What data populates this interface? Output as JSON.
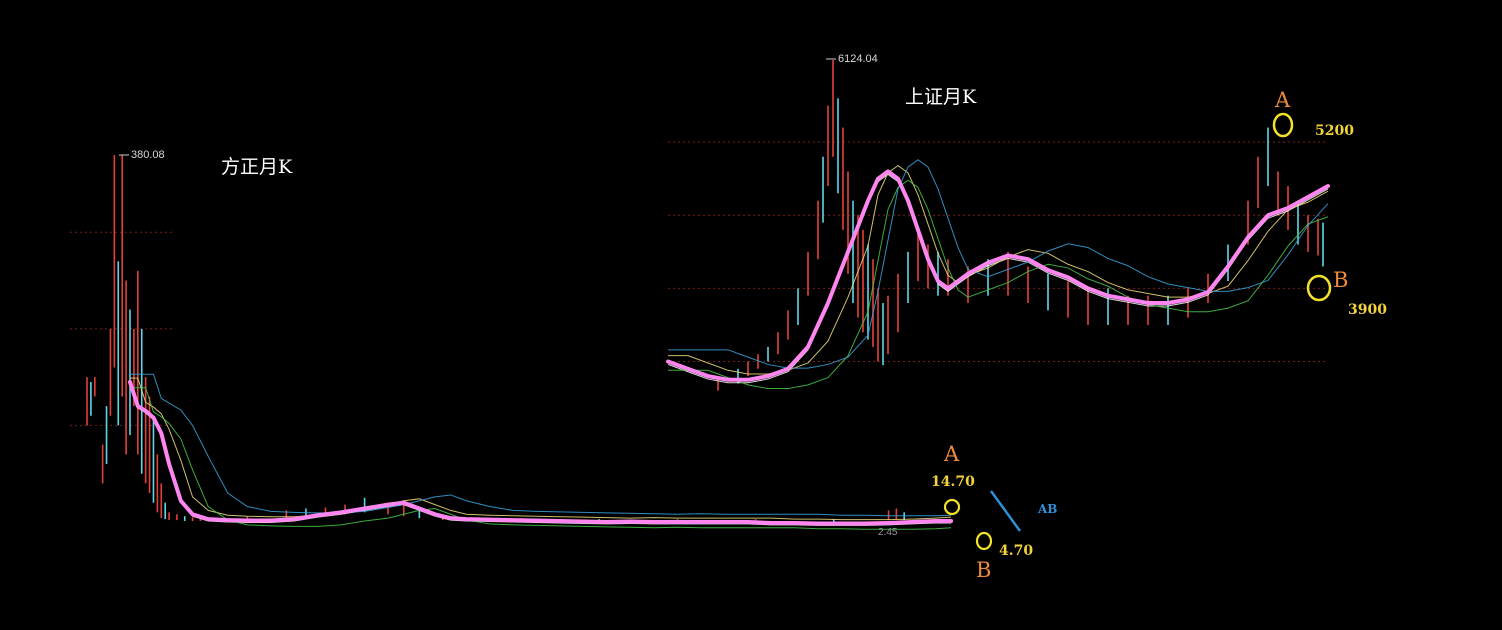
{
  "chart_data": [
    {
      "type": "line",
      "title": "方正月K",
      "peak_label": "380.08",
      "low_label": "2.45",
      "annotations": {
        "point_a_letter": "A",
        "point_a_value": "14.70",
        "point_b_letter": "B",
        "point_b_value": "4.70",
        "ab_label": "AB"
      },
      "ylim": [
        0,
        400
      ],
      "gridlines": [
        100,
        200,
        300
      ],
      "series": [
        {
          "color": "#ff86f0",
          "x": [
            0,
            2,
            4,
            6,
            8,
            10,
            13,
            16,
            20,
            25,
            30,
            36,
            42,
            48,
            54,
            60,
            66,
            70,
            74,
            78,
            82,
            86,
            92,
            98,
            104,
            110,
            116,
            122,
            128,
            134,
            140,
            146,
            152,
            158,
            164,
            170,
            176,
            182,
            188,
            194,
            200,
            206,
            210
          ],
          "y": [
            145,
            120,
            115,
            108,
            92,
            60,
            22,
            8,
            3,
            2,
            1.5,
            1.5,
            3,
            7,
            10,
            14,
            18,
            20,
            14,
            8,
            4,
            3,
            2.5,
            2,
            1.5,
            1,
            0.5,
            0,
            0.5,
            0,
            0,
            0,
            0,
            0,
            -1,
            -1,
            -1.5,
            -1.5,
            -1.5,
            -1,
            0,
            1,
            1
          ]
        }
      ],
      "candles": {
        "x": [
          -11,
          -10,
          -9,
          -7,
          -6,
          -5,
          -4,
          -3,
          -2,
          -1,
          0,
          1,
          2,
          3,
          4,
          5,
          6,
          7,
          8,
          9,
          10,
          12,
          14,
          16,
          18,
          20,
          30,
          40,
          45,
          50,
          55,
          60,
          66,
          70,
          74,
          80,
          100,
          120,
          140,
          160,
          180,
          194,
          196,
          198
        ],
        "high": [
          150,
          145,
          150,
          80,
          120,
          200,
          380,
          270,
          380,
          250,
          220,
          200,
          260,
          200,
          150,
          130,
          110,
          70,
          40,
          20,
          10,
          8,
          6,
          5,
          4,
          4,
          6,
          12,
          14,
          15,
          18,
          25,
          20,
          18,
          12,
          6,
          4,
          3,
          3,
          3,
          3,
          12,
          14,
          10
        ],
        "low": [
          100,
          110,
          130,
          40,
          60,
          110,
          160,
          100,
          130,
          70,
          90,
          120,
          70,
          50,
          40,
          30,
          20,
          10,
          4,
          3,
          2,
          2,
          1,
          1,
          1,
          1,
          1,
          3,
          5,
          6,
          8,
          10,
          8,
          6,
          4,
          2,
          1,
          1,
          0,
          0,
          0,
          2,
          3,
          2
        ]
      }
    },
    {
      "type": "line",
      "title": "上证月K",
      "peak_label": "6124.04",
      "annotations": {
        "point_a_letter": "A",
        "point_a_value": "5200",
        "point_b_letter": "B",
        "point_b_value": "3900"
      },
      "ylim": [
        1500,
        6500
      ],
      "gridlines": [
        2000,
        3000,
        4000,
        5000
      ],
      "series": [
        {
          "color": "#ff86f0",
          "x": [
            0,
            20,
            40,
            60,
            80,
            100,
            120,
            140,
            160,
            180,
            200,
            210,
            220,
            230,
            240,
            250,
            260,
            270,
            280,
            290,
            300,
            320,
            340,
            360,
            380,
            400,
            420,
            440,
            460,
            480,
            500,
            520,
            540,
            560,
            580,
            600,
            620,
            640,
            660
          ],
          "y": [
            2000,
            1900,
            1800,
            1750,
            1750,
            1800,
            1900,
            2200,
            2800,
            3500,
            4200,
            4500,
            4600,
            4500,
            4200,
            3800,
            3400,
            3100,
            3000,
            3100,
            3200,
            3350,
            3450,
            3400,
            3250,
            3150,
            3000,
            2900,
            2850,
            2800,
            2800,
            2850,
            2950,
            3300,
            3700,
            4000,
            4100,
            4250,
            4400
          ]
        }
      ],
      "candles": {
        "x": [
          50,
          70,
          80,
          90,
          100,
          110,
          120,
          130,
          140,
          150,
          155,
          160,
          165,
          170,
          175,
          180,
          185,
          190,
          195,
          200,
          205,
          210,
          215,
          220,
          230,
          240,
          250,
          260,
          270,
          280,
          300,
          320,
          340,
          360,
          380,
          400,
          420,
          440,
          460,
          480,
          500,
          520,
          540,
          560,
          580,
          590,
          600,
          610,
          620,
          630,
          640,
          650,
          655
        ],
        "high": [
          1800,
          1900,
          2000,
          2100,
          2200,
          2400,
          2700,
          3000,
          3500,
          4200,
          4800,
          5500,
          6124,
          5600,
          5200,
          4600,
          4200,
          4000,
          3800,
          3600,
          3400,
          3000,
          2800,
          2900,
          3200,
          3500,
          3800,
          3600,
          3500,
          3400,
          3300,
          3400,
          3500,
          3300,
          3200,
          3100,
          3000,
          3000,
          2900,
          2900,
          2900,
          3000,
          3200,
          3600,
          4200,
          4800,
          5200,
          4600,
          4400,
          4200,
          4000,
          3950,
          3900
        ],
        "low": [
          1600,
          1700,
          1800,
          1900,
          2000,
          2100,
          2300,
          2500,
          2900,
          3400,
          3900,
          4400,
          4800,
          4300,
          3800,
          3200,
          2800,
          2600,
          2400,
          2300,
          2200,
          2000,
          1950,
          2100,
          2400,
          2800,
          3100,
          3000,
          2900,
          2900,
          2800,
          2900,
          2900,
          2800,
          2700,
          2600,
          2500,
          2500,
          2500,
          2500,
          2500,
          2600,
          2800,
          3100,
          3600,
          4100,
          4400,
          4000,
          3800,
          3600,
          3500,
          3450,
          3300
        ]
      }
    }
  ]
}
